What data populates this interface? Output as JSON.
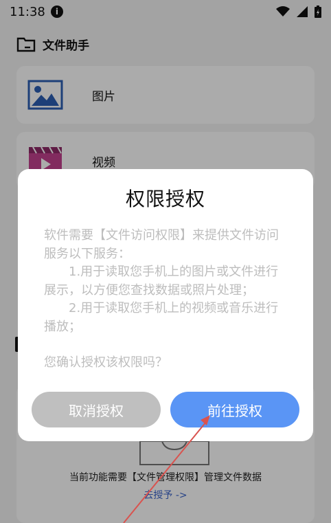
{
  "status_bar": {
    "time": "11:38",
    "info_icon_glyph": "i"
  },
  "header": {
    "title": "文件助手"
  },
  "list": [
    {
      "label": "图片",
      "icon": "image-icon"
    },
    {
      "label": "视频",
      "icon": "video-icon"
    }
  ],
  "empty_state": {
    "message": "当前功能需要【文件管理权限】管理文件数据",
    "grant_link": "去授予 ->"
  },
  "dialog": {
    "title": "权限授权",
    "intro": "软件需要【文件访问权限】来提供文件访问服务以下服务：",
    "item1": "1.用于读取您手机上的图片或文件进行展示，以方便您查找数据或照片处理；",
    "item2": "2.用于读取您手机上的视频或音乐进行播放；",
    "confirm": "您确认授权该权限吗？",
    "cancel_label": "取消授权",
    "go_label": "前往授权"
  },
  "colors": {
    "accent": "#5a95f5",
    "cancel": "#bfbfbf",
    "link": "#3a63c9",
    "annotation_arrow": "#d9534f"
  }
}
